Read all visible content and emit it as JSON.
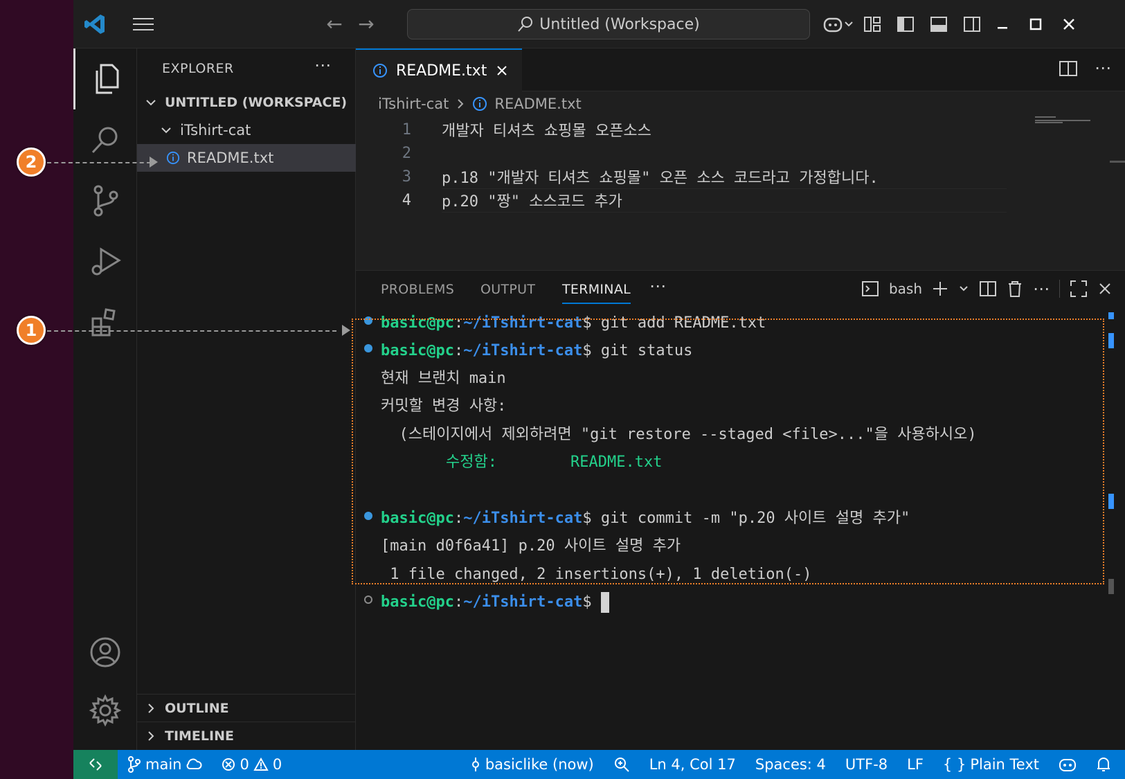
{
  "titlebar": {
    "search_text": "Untitled (Workspace)"
  },
  "sidebar": {
    "title": "EXPLORER",
    "workspace": "UNTITLED (WORKSPACE)",
    "folder": "iTshirt-cat",
    "file": "README.txt",
    "outline": "OUTLINE",
    "timeline": "TIMELINE"
  },
  "editor": {
    "tab_label": "README.txt",
    "breadcrumb_folder": "iTshirt-cat",
    "breadcrumb_file": "README.txt",
    "lines": [
      {
        "num": "1",
        "text": "개발자 티셔츠 쇼핑몰 오픈소스"
      },
      {
        "num": "2",
        "text": ""
      },
      {
        "num": "3",
        "text": "p.18 \"개발자 티셔츠 쇼핑몰\" 오픈 소스 코드라고 가정합니다."
      },
      {
        "num": "4",
        "text": "p.20 \"짱\" 소스코드 추가"
      }
    ]
  },
  "panel": {
    "tabs": [
      "PROBLEMS",
      "OUTPUT",
      "TERMINAL"
    ],
    "shell": "bash"
  },
  "terminal": {
    "prompt_user": "basic@pc",
    "prompt_sep": ":",
    "prompt_path": "~/iTshirt-cat",
    "prompt_end": "$",
    "cmd1": " git add README.txt",
    "cmd2": " git status",
    "out1": "현재 브랜치 main",
    "out2": "커밋할 변경 사항:",
    "out3": "  (스테이지에서 제외하려면 \"git restore --staged <file>...\"을 사용하시오)",
    "out4_label": "수정함:",
    "out4_file": "README.txt",
    "cmd3": " git commit -m \"p.20 사이트 설명 추가\"",
    "out5": "[main d0f6a41] p.20 사이트 설명 추가",
    "out6": " 1 file changed, 2 insertions(+), 1 deletion(-)"
  },
  "statusbar": {
    "branch": "main",
    "errors": "0",
    "warnings": "0",
    "blame": "basiclike (now)",
    "position": "Ln 4, Col 17",
    "spaces": "Spaces: 4",
    "encoding": "UTF-8",
    "eol": "LF",
    "language": "Plain Text"
  },
  "callouts": {
    "one": "1",
    "two": "2"
  },
  "colors": {
    "accent": "#0078d4",
    "callout": "#f07f29",
    "prompt_user": "#23d18b",
    "prompt_path": "#3b8eea"
  }
}
